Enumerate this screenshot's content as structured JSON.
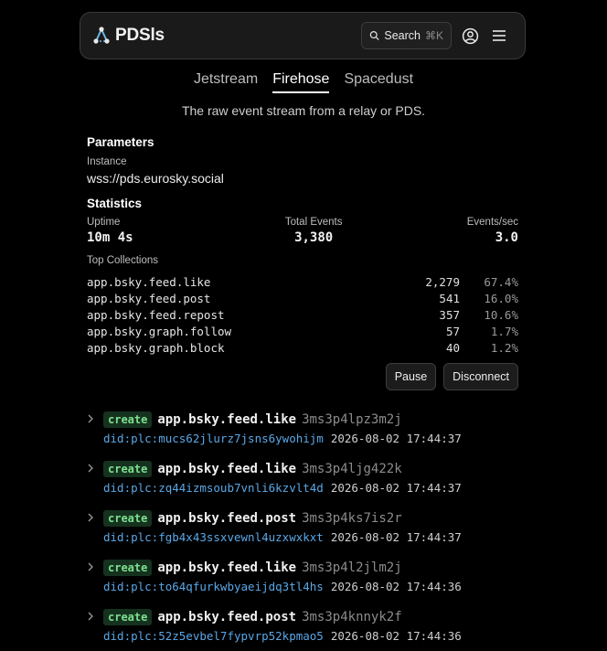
{
  "header": {
    "logo_text": "PDSls",
    "search_label": "Search",
    "search_shortcut": "⌘K",
    "user_icon": "user-circle-icon",
    "menu_icon": "hamburger-menu-icon"
  },
  "tabs": [
    {
      "label": "Jetstream",
      "active": false
    },
    {
      "label": "Firehose",
      "active": true
    },
    {
      "label": "Spacedust",
      "active": false
    }
  ],
  "description": "The raw event stream from a relay or PDS.",
  "parameters": {
    "title": "Parameters",
    "instance_label": "Instance",
    "instance_value": "wss://pds.eurosky.social"
  },
  "statistics": {
    "title": "Statistics",
    "uptime_label": "Uptime",
    "uptime_value": "10m 4s",
    "total_label": "Total Events",
    "total_value": "3,380",
    "rate_label": "Events/sec",
    "rate_value": "3.0",
    "top_collections_label": "Top Collections",
    "collections": [
      {
        "name": "app.bsky.feed.like",
        "count": "2,279",
        "pct": "67.4%"
      },
      {
        "name": "app.bsky.feed.post",
        "count": "541",
        "pct": "16.0%"
      },
      {
        "name": "app.bsky.feed.repost",
        "count": "357",
        "pct": "10.6%"
      },
      {
        "name": "app.bsky.graph.follow",
        "count": "57",
        "pct": "1.7%"
      },
      {
        "name": "app.bsky.graph.block",
        "count": "40",
        "pct": "1.2%"
      }
    ]
  },
  "controls": {
    "pause_label": "Pause",
    "disconnect_label": "Disconnect"
  },
  "events": [
    {
      "action": "create",
      "collection": "app.bsky.feed.like",
      "rkey": "3ms3p4lpz3m2j",
      "did": "did:plc:mucs62jlurz7jsns6ywohijm",
      "time": "2026-08-02 17:44:37"
    },
    {
      "action": "create",
      "collection": "app.bsky.feed.like",
      "rkey": "3ms3p4ljg422k",
      "did": "did:plc:zq44izmsoub7vnli6kzvlt4d",
      "time": "2026-08-02 17:44:37"
    },
    {
      "action": "create",
      "collection": "app.bsky.feed.post",
      "rkey": "3ms3p4ks7is2r",
      "did": "did:plc:fgb4x43ssxvewnl4uzxwxkxt",
      "time": "2026-08-02 17:44:37"
    },
    {
      "action": "create",
      "collection": "app.bsky.feed.like",
      "rkey": "3ms3p4l2jlm2j",
      "did": "did:plc:to64qfurkwbyaeijdq3tl4hs",
      "time": "2026-08-02 17:44:36"
    },
    {
      "action": "create",
      "collection": "app.bsky.feed.post",
      "rkey": "3ms3p4knnyk2f",
      "did": "did:plc:52z5evbel7fypvrp52kpmao5",
      "time": "2026-08-02 17:44:36"
    }
  ],
  "colors": {
    "background": "#000000",
    "badge_bg": "#15321f",
    "badge_text": "#7ee08f",
    "did_link": "#5aa7e6",
    "logo_accent": "#6fb7e8"
  }
}
